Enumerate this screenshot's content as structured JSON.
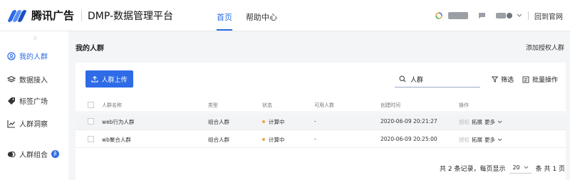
{
  "header": {
    "brand": "腾讯广告",
    "app_name": "DMP-数据管理平台",
    "nav": [
      {
        "label": "首页",
        "active": true
      },
      {
        "label": "帮助中心",
        "active": false
      }
    ],
    "back_link": "回到官网"
  },
  "sidebar": {
    "items": [
      {
        "label": "我的人群",
        "icon": "user-circle-icon",
        "active": true
      },
      {
        "label": "数据接入",
        "icon": "layers-icon",
        "active": false
      },
      {
        "label": "标签广场",
        "icon": "tag-icon",
        "active": false
      },
      {
        "label": "人群洞察",
        "icon": "line-chart-icon",
        "active": false
      },
      {
        "label": "人群组合",
        "icon": "combine-icon",
        "active": false,
        "badge": "β"
      }
    ]
  },
  "page": {
    "title": "我的人群",
    "add_authorized": "添加授权人群"
  },
  "toolbar": {
    "upload_label": "人群上传",
    "search_value": "人群",
    "filter_label": "筛选",
    "batch_label": "批量操作"
  },
  "table": {
    "columns": [
      "人群名称",
      "类型",
      "状态",
      "可用人数",
      "创建时间",
      "操作"
    ],
    "rows": [
      {
        "name": "web行为人群",
        "type": "组合人群",
        "status": "计算中",
        "available": "-",
        "created": "2020-06-09 20:21:27",
        "op_authorize": "授权",
        "op_expand": "拓展",
        "op_more": "更多"
      },
      {
        "name": "wb聚合人群",
        "type": "组合人群",
        "status": "计算中",
        "available": "-",
        "created": "2020-06-09 20:25:00",
        "op_authorize": "授权",
        "op_expand": "拓展",
        "op_more": "更多"
      }
    ]
  },
  "pagination": {
    "total_text": "共 2 条记录，每页显示",
    "page_size": "20",
    "pages_text": "条 共 1 页"
  },
  "colors": {
    "accent": "#2e6be6",
    "status_computing": "#f0a34a"
  }
}
